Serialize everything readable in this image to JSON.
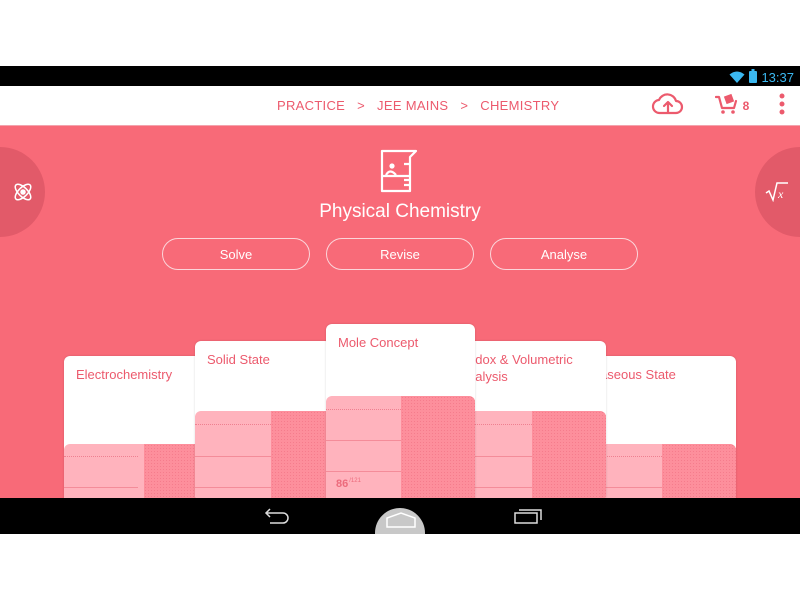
{
  "status_bar": {
    "time": "13:37",
    "wifi_icon": "wifi-icon",
    "battery_icon": "battery-icon"
  },
  "header": {
    "breadcrumb": [
      "PRACTICE",
      "JEE MAINS",
      "CHEMISTRY"
    ],
    "breadcrumb_separator": ">",
    "upload_icon": "cloud-upload-icon",
    "cart_icon": "cart-icon",
    "cart_count": "8",
    "menu_icon": "more-vert-icon"
  },
  "main": {
    "background_color": "#f86a78",
    "accent_color": "#ec5a6d",
    "left_nav_icon": "atom-icon",
    "right_nav_icon": "square-root-icon",
    "subject_icon": "beaker-icon",
    "subject_title": "Physical Chemistry",
    "modes": [
      {
        "label": "Solve"
      },
      {
        "label": "Revise"
      },
      {
        "label": "Analyse"
      }
    ],
    "chapters": [
      {
        "title": "Electrochemistry",
        "score": "",
        "total": ""
      },
      {
        "title": "Solid State",
        "score": "",
        "total": ""
      },
      {
        "title": "Mole Concept",
        "score": "86",
        "total": "121"
      },
      {
        "title": "Redox & Volumetric Analysis",
        "visible_title": "edox & Volumetric nalysis",
        "score": "",
        "total": ""
      },
      {
        "title": "Gaseous State",
        "visible_title": "aseous State",
        "score": "",
        "total": ""
      }
    ]
  },
  "nav_bar": {
    "back_icon": "back-icon",
    "home_icon": "home-icon",
    "recents_icon": "recents-icon"
  }
}
